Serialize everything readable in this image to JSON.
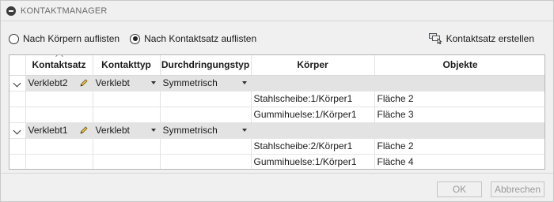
{
  "panel": {
    "title": "KONTAKTMANAGER"
  },
  "options": {
    "by_bodies_label": "Nach Körpern auflisten",
    "by_contact_set_label": "Nach Kontaktsatz auflisten",
    "selected": "by_contact_set"
  },
  "toolbar": {
    "create_label": "Kontaktsatz erstellen"
  },
  "table": {
    "headers": [
      "Kontaktsatz",
      "Kontakttyp",
      "Durchdringungstyp",
      "Körper",
      "Objekte"
    ],
    "groups": [
      {
        "name": "Verklebt2",
        "type": "Verklebt",
        "penetration": "Symmetrisch",
        "rows": [
          {
            "body": "Stahlscheibe:1/Körper1",
            "object": "Fläche 2"
          },
          {
            "body": "Gummihuelse:1/Körper1",
            "object": "Fläche 3"
          }
        ]
      },
      {
        "name": "Verklebt1",
        "type": "Verklebt",
        "penetration": "Symmetrisch",
        "rows": [
          {
            "body": "Stahlscheibe:2/Körper1",
            "object": "Fläche 2"
          },
          {
            "body": "Gummihuelse:1/Körper1",
            "object": "Fläche 4"
          }
        ]
      }
    ]
  },
  "buttons": {
    "ok": "OK",
    "cancel": "Abbrechen"
  }
}
